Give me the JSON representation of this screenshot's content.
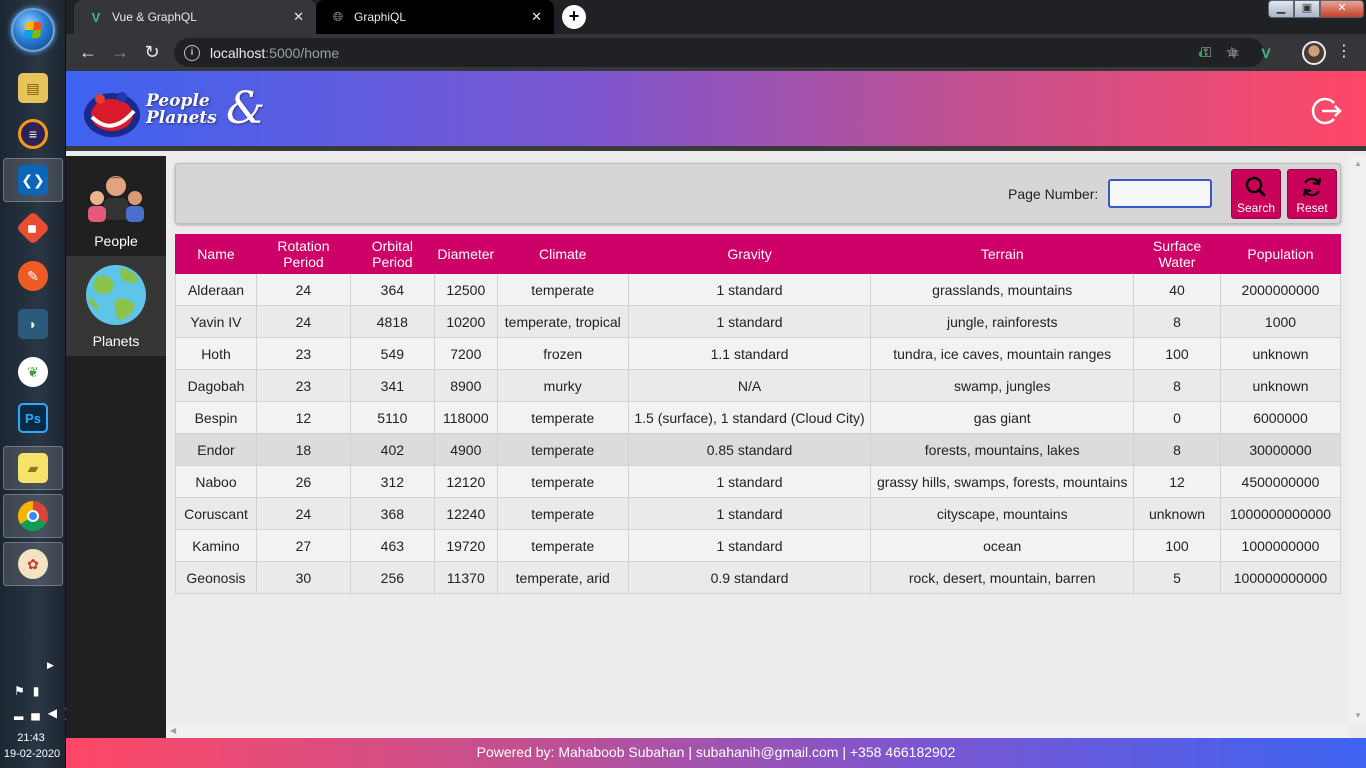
{
  "browser": {
    "tabs": [
      {
        "title": "Vue & GraphQL",
        "active": true
      },
      {
        "title": "GraphiQL",
        "active": false
      }
    ],
    "url_host": "localhost",
    "url_path": ":5000/home"
  },
  "taskbar": {
    "time": "21:43",
    "date": "19-02-2020",
    "apps": [
      "windows-explorer",
      "eclipse",
      "vscode",
      "git",
      "postman",
      "mysql-workbench",
      "mongodb",
      "photoshop",
      "sticky-notes",
      "chrome",
      "paint"
    ]
  },
  "app": {
    "logo_line1": "People",
    "logo_line2": "Planets",
    "logo_amp": "&",
    "nav": [
      {
        "label": "People",
        "icon": "people-icon"
      },
      {
        "label": "Planets",
        "icon": "planet-icon"
      }
    ],
    "search": {
      "page_number_label": "Page Number:",
      "page_number_value": "",
      "search_label": "Search",
      "reset_label": "Reset"
    },
    "table": {
      "headers": [
        "Name",
        "Rotation Period",
        "Orbital Period",
        "Diameter",
        "Climate",
        "Gravity",
        "Terrain",
        "Surface Water",
        "Population"
      ],
      "rows": [
        [
          "Alderaan",
          "24",
          "364",
          "12500",
          "temperate",
          "1 standard",
          "grasslands, mountains",
          "40",
          "2000000000"
        ],
        [
          "Yavin IV",
          "24",
          "4818",
          "10200",
          "temperate, tropical",
          "1 standard",
          "jungle, rainforests",
          "8",
          "1000"
        ],
        [
          "Hoth",
          "23",
          "549",
          "7200",
          "frozen",
          "1.1 standard",
          "tundra, ice caves, mountain ranges",
          "100",
          "unknown"
        ],
        [
          "Dagobah",
          "23",
          "341",
          "8900",
          "murky",
          "N/A",
          "swamp, jungles",
          "8",
          "unknown"
        ],
        [
          "Bespin",
          "12",
          "5110",
          "118000",
          "temperate",
          "1.5 (surface), 1 standard (Cloud City)",
          "gas giant",
          "0",
          "6000000"
        ],
        [
          "Endor",
          "18",
          "402",
          "4900",
          "temperate",
          "0.85 standard",
          "forests, mountains, lakes",
          "8",
          "30000000"
        ],
        [
          "Naboo",
          "26",
          "312",
          "12120",
          "temperate",
          "1 standard",
          "grassy hills, swamps, forests, mountains",
          "12",
          "4500000000"
        ],
        [
          "Coruscant",
          "24",
          "368",
          "12240",
          "temperate",
          "1 standard",
          "cityscape, mountains",
          "unknown",
          "1000000000000"
        ],
        [
          "Kamino",
          "27",
          "463",
          "19720",
          "temperate",
          "1 standard",
          "ocean",
          "100",
          "1000000000"
        ],
        [
          "Geonosis",
          "30",
          "256",
          "11370",
          "temperate, arid",
          "0.9 standard",
          "rock, desert, mountain, barren",
          "5",
          "100000000000"
        ]
      ]
    },
    "footer": "Powered by: Mahaboob Subahan | subahanih@gmail.com | +358 466182902"
  }
}
